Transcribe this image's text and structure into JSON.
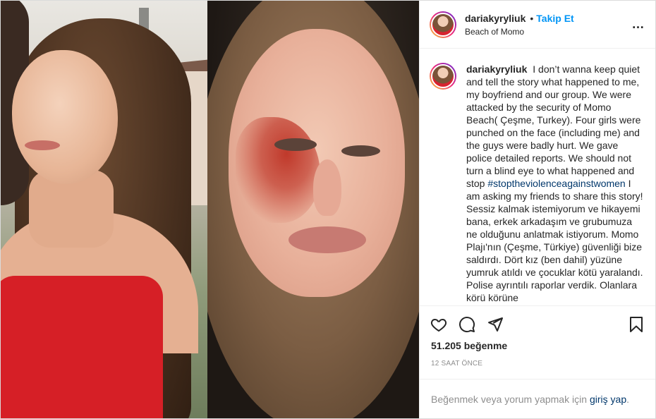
{
  "post": {
    "username": "dariakyryliuk",
    "separator": "•",
    "follow_label": "Takip Et",
    "location": "Beach of Momo",
    "more_icon": "…",
    "caption_part1": "I don’t wanna keep quiet and tell the story what happened to me, my boyfriend and our group. We were attacked by the security of Momo Beach( Çeşme, Turkey). Four girls were punched on the face (including me) and the guys were badly hurt. We gave police detailed reports. We should not turn a blind eye to what happened and stop",
    "hashtag": "#stoptheviolenceagainstwomen",
    "caption_part2": "I am asking my friends to share this story! Sessiz kalmak istemiyorum ve hikayemi bana, erkek arkadaşım ve grubumuza ne olduğunu anlatmak istiyorum. Momo Plajı'nın (Çeşme, Türkiye) güvenliği bize saldırdı. Dört kız (ben dahil) yüzüne yumruk atıldı ve çocuklar kötü yaralandı. Polise ayrıntılı raporlar verdik. Olanlara körü körüne",
    "likes": "51.205 beğenme",
    "time": "12 SAAT ÖNCE",
    "login_prompt": "Beğenmek veya yorum yapmak için",
    "login_link": "giriş yap",
    "login_end": "."
  },
  "icons": {
    "like": "heart-icon",
    "comment": "comment-icon",
    "share": "paper-plane-icon",
    "save": "bookmark-icon",
    "more": "more-dots-icon"
  },
  "colors": {
    "link_blue": "#0095f6",
    "hashtag": "#00376b",
    "muted": "#8e8e8e"
  }
}
